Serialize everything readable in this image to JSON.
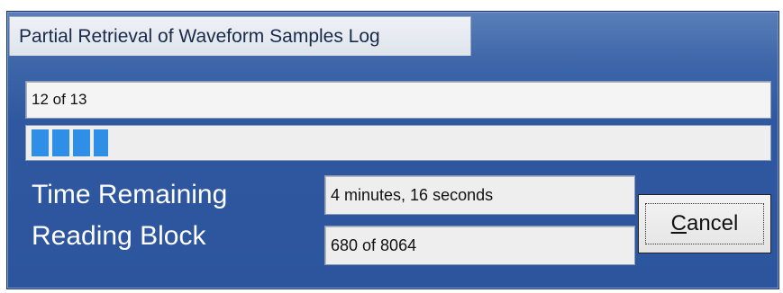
{
  "dialog": {
    "title": "Partial Retrieval of Waveform Samples Log",
    "status": "12 of 13",
    "progress": {
      "fraction": 0.104,
      "color": "#2f8ee6"
    },
    "time_remaining": {
      "label": "Time Remaining",
      "value": "4 minutes, 16 seconds"
    },
    "reading_block": {
      "label": "Reading Block",
      "value": "680 of 8064"
    },
    "cancel_label": "Cancel"
  }
}
